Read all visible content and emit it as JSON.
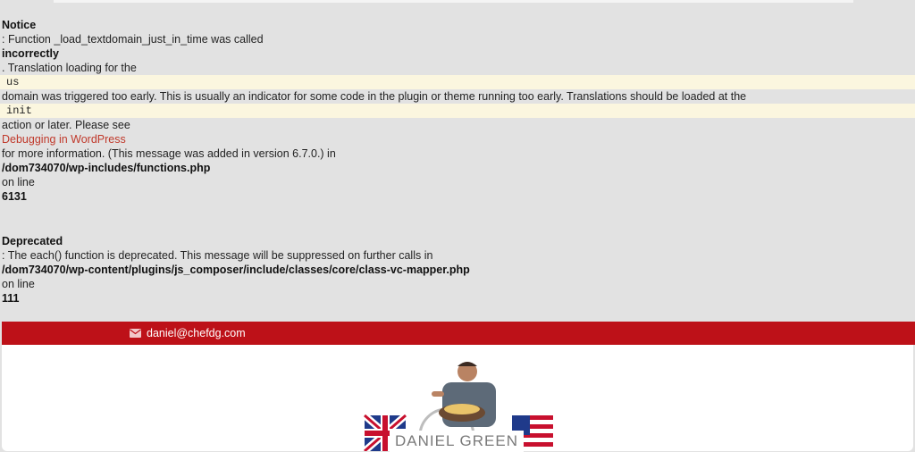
{
  "notice": {
    "label": "Notice",
    "line1": ": Function _load_textdomain_just_in_time was called",
    "emph": "incorrectly",
    "line2": ". Translation loading for the",
    "code1": "us",
    "line3": "domain was triggered too early. This is usually an indicator for some code in the plugin or theme running too early. Translations should be loaded at the",
    "code2": "init",
    "line4": "action or later. Please see",
    "link": "Debugging in WordPress",
    "line5": "for more information. (This message was added in version 6.7.0.) in",
    "path": "/dom734070/wp-includes/functions.php",
    "online": "on line",
    "lineno": "6131"
  },
  "deprecated": {
    "label": "Deprecated",
    "line1": ": The each() function is deprecated. This message will be suppressed on further calls in",
    "path": "/dom734070/wp-content/plugins/js_composer/include/classes/core/class-vc-mapper.php",
    "online": "on line",
    "lineno": "111"
  },
  "topbar": {
    "email": "daniel@chefdg.com",
    "icon": "envelope-icon",
    "bg": "#bd1118"
  },
  "logo": {
    "text": "DANIEL GREEN"
  }
}
